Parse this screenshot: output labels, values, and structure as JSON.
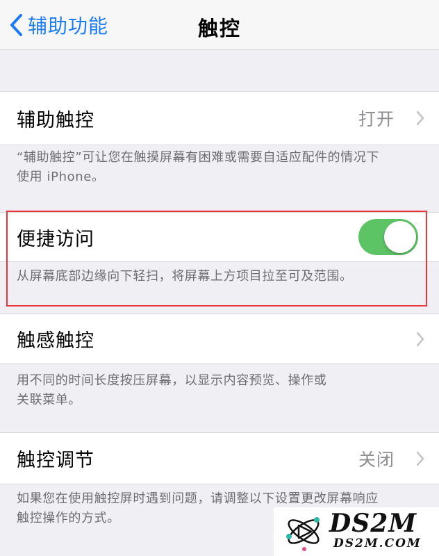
{
  "nav": {
    "back_label": "辅助功能",
    "title": "触控"
  },
  "sections": {
    "assistive_touch": {
      "label": "辅助触控",
      "value": "打开",
      "note_line1": "“辅助触控”可让您在触摸屏幕有困难或需要自适应配件的情况下",
      "note_line2": "使用 iPhone。"
    },
    "reachability": {
      "label": "便捷访问",
      "toggle_on": true,
      "note": "从屏幕底部边缘向下轻扫，将屏幕上方项目拉至可及范围。"
    },
    "haptic_touch": {
      "label": "触感触控",
      "note_line1": "用不同的时间长度按压屏幕，以显示内容预览、操作或",
      "note_line2": "关联菜单。"
    },
    "touch_accommodations": {
      "label": "触控调节",
      "value": "关闭",
      "note_line1": "如果您在使用触控屏时遇到问题，请调整以下设置更改屏幕响应",
      "note_line2": "触控操作的方式。"
    }
  },
  "watermark": {
    "brand": "DS2M",
    "domain": "DS2M.COM"
  },
  "colors": {
    "accent": "#1b7cf5",
    "toggle_on": "#5dc466",
    "highlight_border": "#e8373b"
  }
}
